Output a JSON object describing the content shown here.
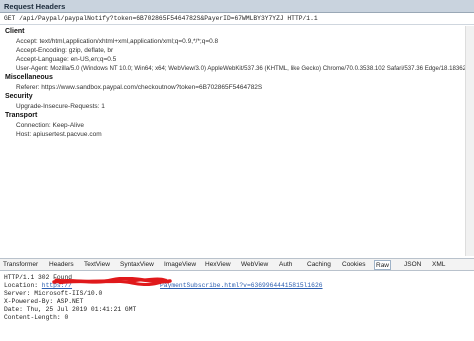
{
  "request_header_title": "Request Headers",
  "request_line": "GET /api/Paypal/paypalNotify?token=6B702865F5464782S&PayerID=67WMLBY3Y7YZJ HTTP/1.1",
  "sections": [
    {
      "title": "Client",
      "items": [
        "Accept: text/html,application/xhtml+xml,application/xml;q=0.9,*/*;q=0.8",
        "Accept-Encoding: gzip, deflate, br",
        "Accept-Language: en-US,en;q=0.5",
        "User-Agent: Mozilla/5.0 (Windows NT 10.0; Win64; x64; WebView/3.0) AppleWebKit/537.36 (KHTML, like Gecko) Chrome/70.0.3538.102 Safari/537.36 Edge/18.18362"
      ]
    },
    {
      "title": "Miscellaneous",
      "items": [
        "Referer: https://www.sandbox.paypal.com/checkoutnow?token=6B702865F5464782S"
      ]
    },
    {
      "title": "Security",
      "items": [
        "Upgrade-Insecure-Requests: 1"
      ]
    },
    {
      "title": "Transport",
      "items": [
        "Connection: Keep-Alive",
        "Host: apiusertest.pacvue.com"
      ]
    }
  ],
  "tabs": [
    "Transformer",
    "Headers",
    "TextView",
    "SyntaxView",
    "ImageView",
    "HexView",
    "WebView",
    "Auth",
    "Caching",
    "Cookies",
    "Raw",
    "JSON",
    "XML"
  ],
  "active_tab": "Raw",
  "response": {
    "status": "HTTP/1.1 302 Found",
    "location_label": "Location: ",
    "location_link_prefix": "https://",
    "location_link_suffix": "PaymentSubscribe.html?v=63699644415815l1626",
    "server": "Server: Microsoft-IIS/10.0",
    "powered_by": "X-Powered-By: ASP.NET",
    "date": "Date: Thu, 25 Jul 2019 01:41:21 GMT",
    "content_length": "Content-Length: 0"
  },
  "colors": {
    "redaction": "#e0191b",
    "link": "#2a5db0"
  }
}
